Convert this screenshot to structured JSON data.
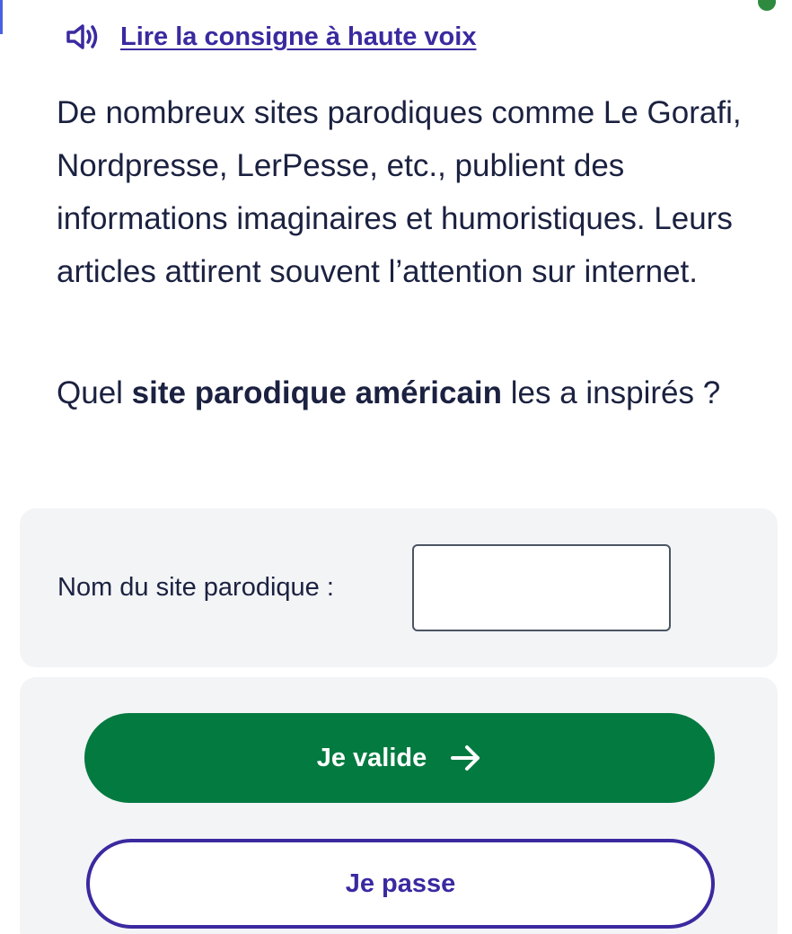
{
  "read_aloud": {
    "label": "Lire la consigne à haute voix",
    "icon": "speaker-icon"
  },
  "statement": "De nombreux sites parodiques comme Le Gorafi, Nordpresse, LerPesse, etc., publient des informations imaginaires et humoristiques. Leurs articles attirent souvent l’attention sur internet.",
  "question": {
    "before": "Quel ",
    "emphasis": "site parodique américain",
    "after": " les a inspirés ?"
  },
  "answer": {
    "label": "Nom du site parodique :",
    "value": "",
    "placeholder": ""
  },
  "actions": {
    "validate_label": "Je valide",
    "validate_icon": "arrow-right-icon",
    "skip_label": "Je passe"
  },
  "colors": {
    "primary_text": "#1b2140",
    "link": "#3a2aa0",
    "validate_bg": "#037a40",
    "card_bg": "#f3f4f6"
  }
}
